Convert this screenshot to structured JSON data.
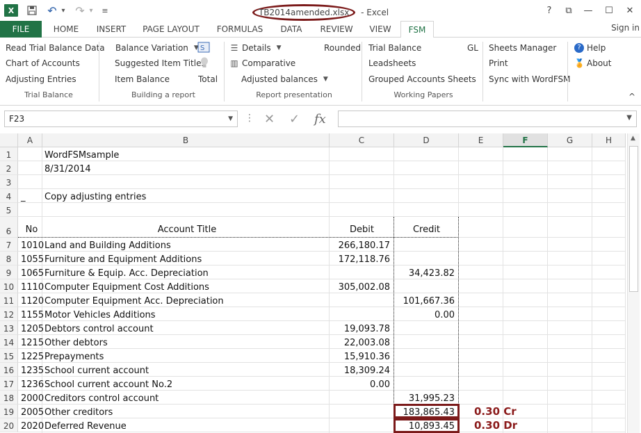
{
  "window": {
    "file_name": "TB2014amended.xlsx",
    "app_name": "Excel",
    "help": "?",
    "restore_ribbon": "⧉",
    "minimize": "—",
    "maximize": "☐",
    "close": "✕"
  },
  "quick_access": {
    "logo": "X",
    "save": "💾",
    "undo": "↶",
    "undo_dd": "▾",
    "redo": "↷",
    "redo_dd": "▾",
    "customize": "≡"
  },
  "tabs": [
    "FILE",
    "HOME",
    "INSERT",
    "PAGE LAYOUT",
    "FORMULAS",
    "DATA",
    "REVIEW",
    "VIEW",
    "FSM"
  ],
  "signin": "Sign in",
  "ribbon": {
    "trial_balance": {
      "items": [
        "Read Trial Balance Data",
        "Chart of Accounts",
        "Adjusting Entries"
      ],
      "label": "Trial Balance"
    },
    "building_report": {
      "balance_variation": "Balance Variation",
      "suggested_titles": "Suggested Item Titles",
      "item_balance": "Item Balance",
      "total": "Total",
      "label": "Building a report"
    },
    "report_presentation": {
      "details": "Details",
      "rounded": "Rounded",
      "comparative": "Comparative",
      "adjusted_balances": "Adjusted balances",
      "label": "Report presentation"
    },
    "working_papers": {
      "trial_balance": "Trial Balance",
      "gl": "GL",
      "leadsheets": "Leadsheets",
      "grouped": "Grouped Accounts Sheets",
      "label": "Working Papers"
    },
    "misc": {
      "sheets_manager": "Sheets Manager",
      "print": "Print",
      "sync": "Sync with WordFSM",
      "help": "Help",
      "about": "About"
    },
    "collapse": "^"
  },
  "formula_bar": {
    "name_box": "F23",
    "name_dd": "▼",
    "dots": "⋮",
    "cancel": "✕",
    "enter": "✓",
    "fx": "fx",
    "formula": "",
    "formula_dd": "▼"
  },
  "columns": [
    "A",
    "B",
    "C",
    "D",
    "E",
    "F",
    "G",
    "H"
  ],
  "selected_column": "F",
  "rows": [
    {
      "n": "1",
      "a": "",
      "b": "WordFSMsample",
      "c": "",
      "d": ""
    },
    {
      "n": "2",
      "a": "",
      "b": "8/31/2014",
      "c": "",
      "d": ""
    },
    {
      "n": "3",
      "a": "",
      "b": "",
      "c": "",
      "d": ""
    },
    {
      "n": "4",
      "a": "_",
      "b": "Copy adjusting entries",
      "c": "",
      "d": ""
    },
    {
      "n": "5",
      "a": "",
      "b": "",
      "c": "",
      "d": ""
    },
    {
      "n": "6",
      "a": "No",
      "b": "Account Title",
      "c": "Debit",
      "d": "Credit"
    },
    {
      "n": "7",
      "a": "1010",
      "b": "Land and Building Additions",
      "c": "266,180.17",
      "d": ""
    },
    {
      "n": "8",
      "a": "1055",
      "b": "Furniture and Equipment Additions",
      "c": "172,118.76",
      "d": ""
    },
    {
      "n": "9",
      "a": "1065",
      "b": "Furniture & Equip. Acc. Depreciation",
      "c": "",
      "d": "34,423.82"
    },
    {
      "n": "10",
      "a": "1110",
      "b": "Computer Equipment Cost Additions",
      "c": "305,002.08",
      "d": ""
    },
    {
      "n": "11",
      "a": "1120",
      "b": "Computer Equipment Acc. Depreciation",
      "c": "",
      "d": "101,667.36"
    },
    {
      "n": "12",
      "a": "1155",
      "b": "Motor Vehicles Additions",
      "c": "",
      "d": "0.00"
    },
    {
      "n": "13",
      "a": "1205",
      "b": "Debtors control account",
      "c": "19,093.78",
      "d": ""
    },
    {
      "n": "14",
      "a": "1215",
      "b": "Other debtors",
      "c": "22,003.08",
      "d": ""
    },
    {
      "n": "15",
      "a": "1225",
      "b": "Prepayments",
      "c": "15,910.36",
      "d": ""
    },
    {
      "n": "16",
      "a": "1235",
      "b": "School current account",
      "c": "18,309.24",
      "d": ""
    },
    {
      "n": "17",
      "a": "1236",
      "b": "School current account No.2",
      "c": "0.00",
      "d": ""
    },
    {
      "n": "18",
      "a": "2000",
      "b": "Creditors control account",
      "c": "",
      "d": "31,995.23"
    },
    {
      "n": "19",
      "a": "2005",
      "b": "Other creditors",
      "c": "",
      "d": "183,865.43"
    },
    {
      "n": "20",
      "a": "2020",
      "b": "Deferred Revenue",
      "c": "",
      "d": "10,893.45"
    }
  ],
  "annotations": {
    "row19": "0.30 Cr",
    "row20": "0.30 Dr"
  },
  "colors": {
    "excel_green": "#217346",
    "highlight": "#7b1a1a"
  }
}
